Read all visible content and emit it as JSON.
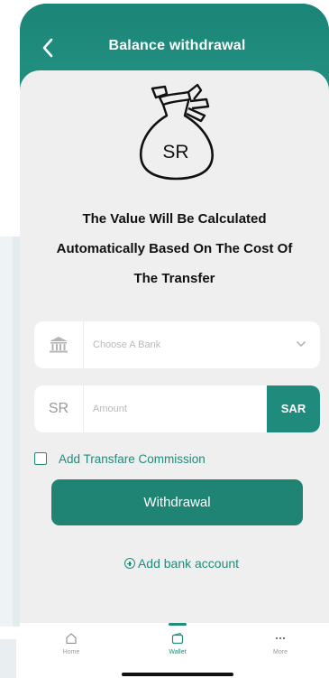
{
  "header": {
    "title": "Balance withdrawal"
  },
  "icons": {
    "back": "chevron-left-icon",
    "money_bag": "money-bag-icon",
    "bank": "bank-icon",
    "chevron": "chevron-down-icon",
    "home": "home-icon",
    "wallet": "wallet-icon",
    "more": "more-icon",
    "add": "plus-circle-icon"
  },
  "bag_label": "SR",
  "info": {
    "line1": "The Value Will Be Calculated",
    "line2": "Automatically Based On The Cost Of",
    "line3": "The Transfer"
  },
  "bank_select": {
    "placeholder": "Choose A Bank"
  },
  "amount": {
    "prefix": "SR",
    "placeholder": "Amount",
    "currency_button": "SAR"
  },
  "commission": {
    "label": "Add Transfare Commission",
    "checked": false
  },
  "withdraw_button": "Withdrawal",
  "add_bank_label": "Add bank account",
  "tabs": [
    {
      "label": "Home",
      "active": false
    },
    {
      "label": "Wallet",
      "active": true
    },
    {
      "label": "More",
      "active": false
    }
  ],
  "colors": {
    "accent": "#1f8c7c",
    "button": "#1f8473",
    "content_bg": "#efefef"
  }
}
